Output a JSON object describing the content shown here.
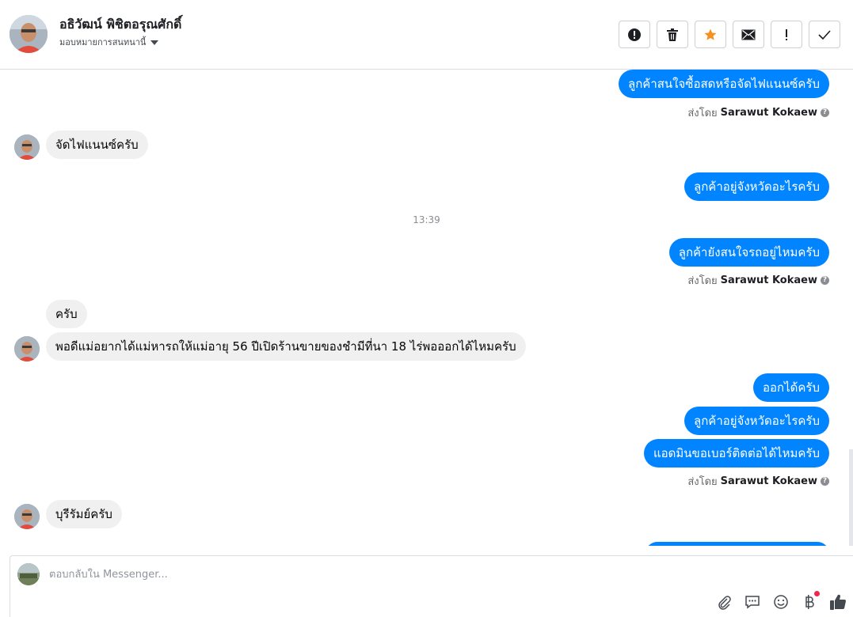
{
  "header": {
    "contact_name": "อธิวัฒน์ พิชิตอรุณศักดิ์",
    "assign_label": "มอบหมายการสนทนานี้",
    "toolbar": [
      {
        "name": "spam-report-button",
        "icon": "alert-circle-icon"
      },
      {
        "name": "delete-button",
        "icon": "trash-icon"
      },
      {
        "name": "star-button",
        "icon": "star-icon"
      },
      {
        "name": "mark-unread-button",
        "icon": "envelope-icon"
      },
      {
        "name": "mark-follow-up-button",
        "icon": "exclamation-icon"
      },
      {
        "name": "mark-done-button",
        "icon": "checkmark-icon"
      }
    ],
    "colors": {
      "star": "#f5901f",
      "accent": "#0084ff"
    }
  },
  "thread": {
    "messages": [
      {
        "text": "ลูกค้าสนใจซื้อสดหรือจัดไฟแนนซ์ครับ",
        "dir": "out"
      },
      {
        "text": "จัดไฟแนนซ์ครับ",
        "dir": "in"
      },
      {
        "text": "ลูกค้าอยู่จังหวัดอะไรครับ",
        "dir": "out"
      },
      {
        "text": "ลูกค้ายังสนใจรถอยู่ไหมครับ",
        "dir": "out"
      },
      {
        "text": "ครับ",
        "dir": "in"
      },
      {
        "text": "พอดีแม่อยากได้แม่หารถให้แม่อายุ 56 ปีเปิดร้านขายของชำมีที่นา 18 ไร่พอออกได้ไหมครับ",
        "dir": "in"
      },
      {
        "text": "ออกได้ครับ",
        "dir": "out"
      },
      {
        "text": "ลูกค้าอยู่จังหวัดอะไรครับ",
        "dir": "out"
      },
      {
        "text": "แอดมินขอเบอร์ติดต่อได้ไหมครับ",
        "dir": "out"
      },
      {
        "text": "บุรีรัมย์ครับ",
        "dir": "in"
      }
    ],
    "timestamp": "13:39",
    "sent_by_prefix": "ส่งโดย",
    "sent_by_name": "Sarawut Kokaew"
  },
  "composer": {
    "placeholder": "ตอบกลับใน Messenger...",
    "icons": [
      "paperclip-icon",
      "saved-reply-icon",
      "emoji-icon",
      "baht-payment-icon",
      "like-thumb-icon"
    ]
  }
}
